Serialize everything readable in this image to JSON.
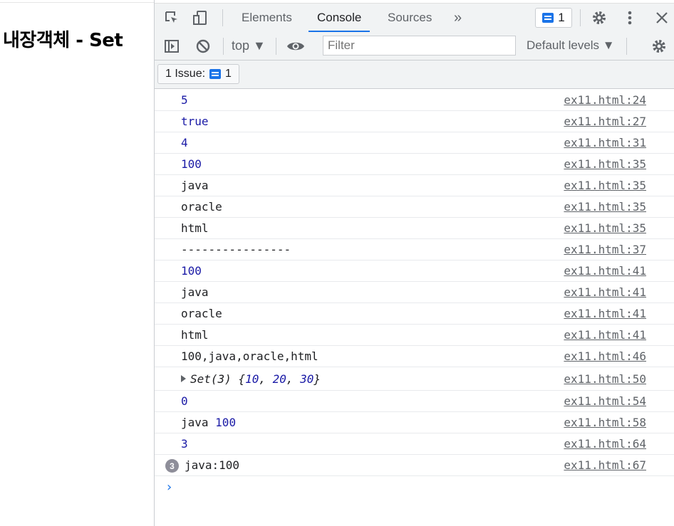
{
  "page": {
    "title": "내장객체 - Set"
  },
  "devtools": {
    "tabs": [
      {
        "label": "Elements"
      },
      {
        "label": "Console"
      },
      {
        "label": "Sources"
      }
    ],
    "more_tabs_label": "»",
    "issues_badge_count": "1",
    "context": "top ▼",
    "filter_placeholder": "Filter",
    "levels_label": "Default levels ▼",
    "issues_button": {
      "label": "1 Issue:",
      "count": "1"
    }
  },
  "console": {
    "rows": [
      {
        "text": "5",
        "type": "number",
        "source": "ex11.html:24"
      },
      {
        "text": "true",
        "type": "number",
        "source": "ex11.html:27"
      },
      {
        "text": "4",
        "type": "number",
        "source": "ex11.html:31"
      },
      {
        "text": "100",
        "type": "number",
        "source": "ex11.html:35"
      },
      {
        "text": "java",
        "type": "string",
        "source": "ex11.html:35"
      },
      {
        "text": "oracle",
        "type": "string",
        "source": "ex11.html:35"
      },
      {
        "text": "html",
        "type": "string",
        "source": "ex11.html:35"
      },
      {
        "text": "----------------",
        "type": "string",
        "source": "ex11.html:37"
      },
      {
        "text": "100",
        "type": "number",
        "source": "ex11.html:41"
      },
      {
        "text": "java",
        "type": "string",
        "source": "ex11.html:41"
      },
      {
        "text": "oracle",
        "type": "string",
        "source": "ex11.html:41"
      },
      {
        "text": "html",
        "type": "string",
        "source": "ex11.html:41"
      },
      {
        "text": "100,java,oracle,html",
        "type": "string",
        "source": "ex11.html:46"
      },
      {
        "text_prefix": "Set(3) {",
        "values": [
          "10",
          "20",
          "30"
        ],
        "text_suffix": "}",
        "type": "set",
        "source": "ex11.html:50"
      },
      {
        "text": "0",
        "type": "number",
        "source": "ex11.html:54"
      },
      {
        "text": "java",
        "text_num": "100",
        "type": "mixed",
        "source": "ex11.html:58"
      },
      {
        "text": "3",
        "type": "number",
        "source": "ex11.html:64"
      },
      {
        "text": "java:100",
        "type": "repeated",
        "repeat_count": "3",
        "source": "ex11.html:67"
      }
    ],
    "prompt_symbol": "›"
  },
  "colors": {
    "accent": "#1a73e8",
    "number": "#1a1aa6",
    "toolbar_bg": "#f1f3f4"
  }
}
